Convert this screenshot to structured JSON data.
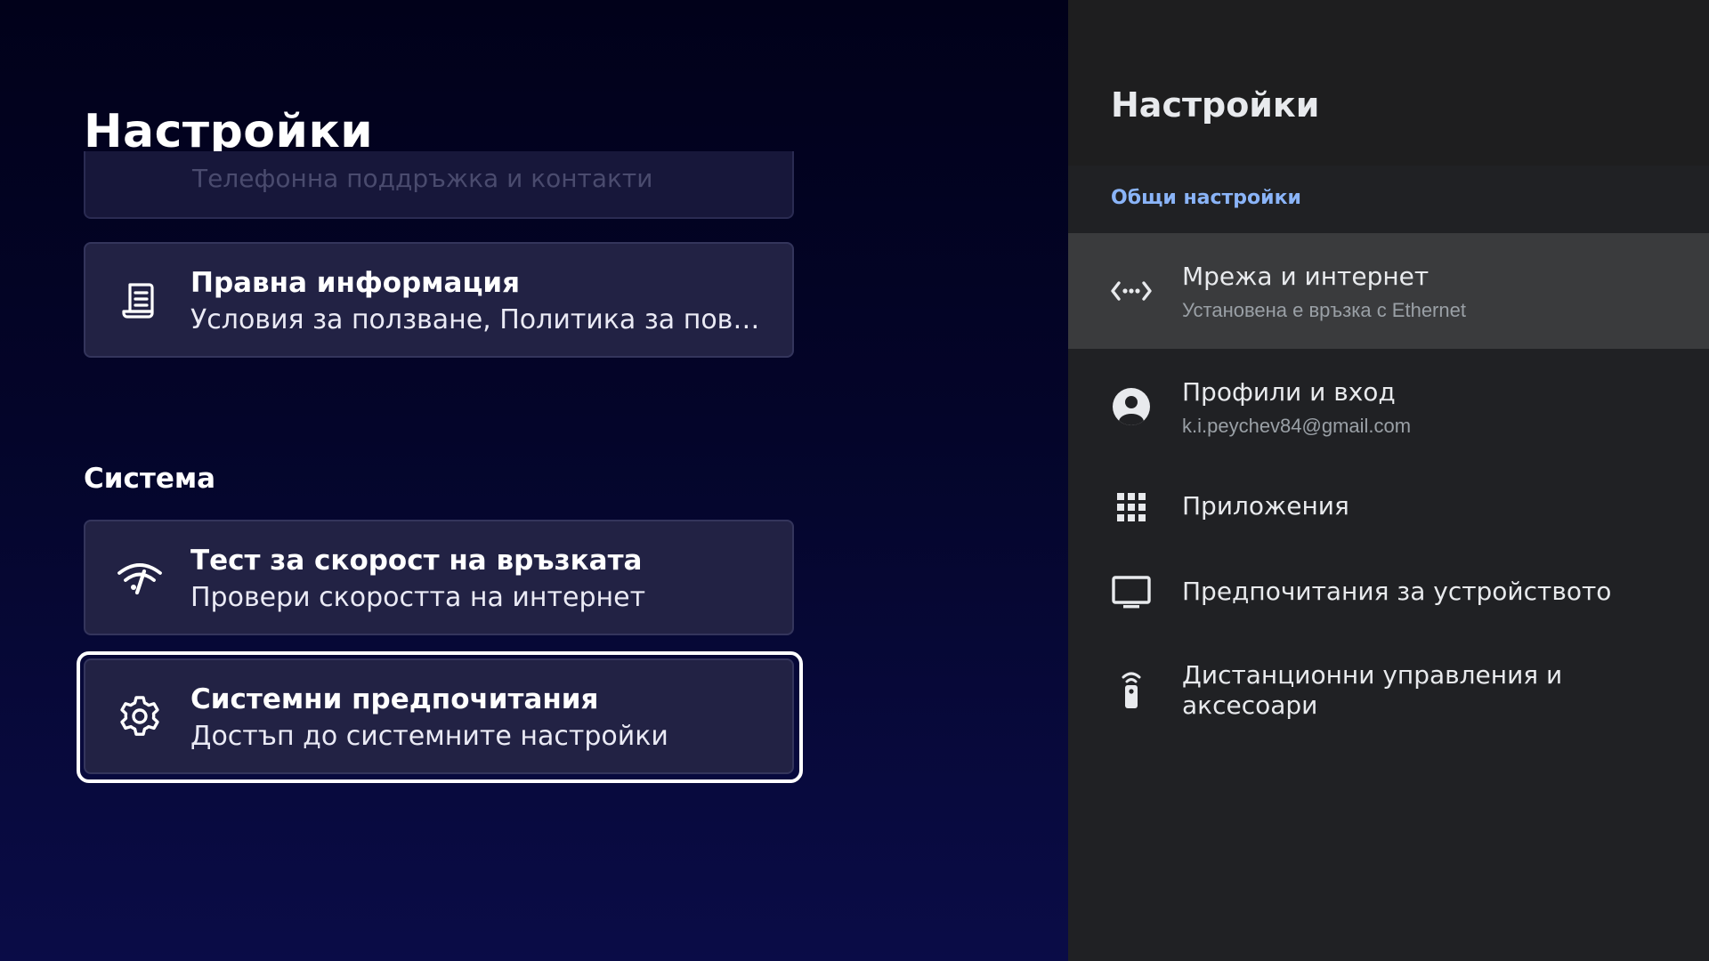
{
  "left": {
    "title": "Настройки",
    "partial_card_text": "Телефонна поддръжка и контакти",
    "legal_card": {
      "title": "Правна информация",
      "subtitle": "Условия за ползване, Политика за поверителност",
      "icon": "document-icon"
    },
    "section_label": "Система",
    "speed_card": {
      "title": "Тест за скорост на връзката",
      "subtitle": "Провери скоростта на интернет",
      "icon": "speed-icon"
    },
    "system_card": {
      "title": "Системни предпочитания",
      "subtitle": "Достъп до системните настройки",
      "icon": "gear-icon"
    }
  },
  "right": {
    "title": "Настройки",
    "category": "Общи настройки",
    "items": [
      {
        "title": "Мрежа и интернет",
        "subtitle": "Установена е връзка с Ethernet",
        "icon": "network-icon"
      },
      {
        "title": "Профили и вход",
        "subtitle": "k.i.peychev84@gmail.com",
        "icon": "account-icon"
      },
      {
        "title": "Приложения",
        "icon": "apps-grid-icon"
      },
      {
        "title": "Предпочитания за устройството",
        "icon": "tv-icon"
      },
      {
        "title": "Дистанционни управления и",
        "title_line2": "аксесоари",
        "icon": "remote-icon"
      }
    ]
  },
  "colors": {
    "accent_link": "#8ab4f8",
    "focus_ring": "#ffffff",
    "card_bg": "#222244",
    "right_pane_bg": "#202124"
  }
}
